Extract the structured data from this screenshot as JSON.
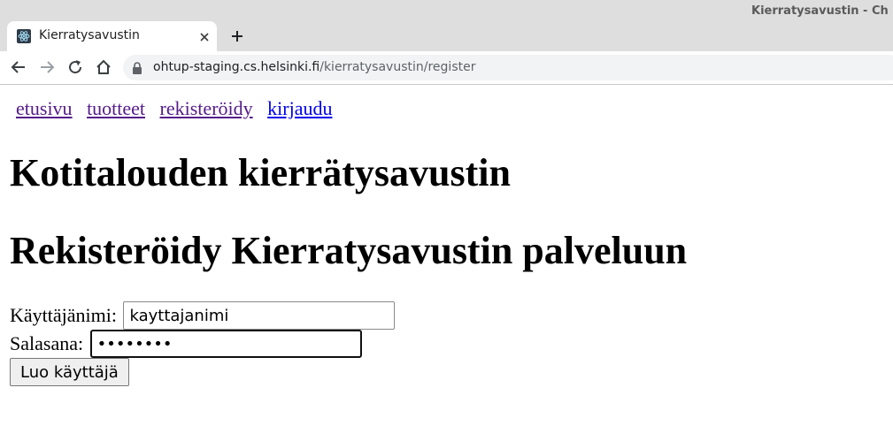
{
  "window": {
    "title": "Kierratysavustin - Ch"
  },
  "tab": {
    "title": "Kierratysavustin"
  },
  "address": {
    "host": "ohtup-staging.cs.helsinki.fi",
    "path": "/kierratysavustin/register"
  },
  "nav": {
    "items": [
      {
        "label": "etusivu",
        "visited": true
      },
      {
        "label": "tuotteet",
        "visited": true
      },
      {
        "label": "rekisteröidy",
        "visited": true
      },
      {
        "label": "kirjaudu",
        "visited": false
      }
    ]
  },
  "page": {
    "heading": "Kotitalouden kierrätysavustin",
    "subheading": "Rekisteröidy Kierratysavustin palveluun"
  },
  "form": {
    "username_label": "Käyttäjänimi:",
    "username_value": "kayttajanimi",
    "password_label": "Salasana:",
    "password_value": "salasana",
    "submit_label": "Luo käyttäjä"
  },
  "colors": {
    "link_visited": "#551a8b",
    "link_unvisited": "#0000ee",
    "chrome_bg": "#dedede"
  }
}
